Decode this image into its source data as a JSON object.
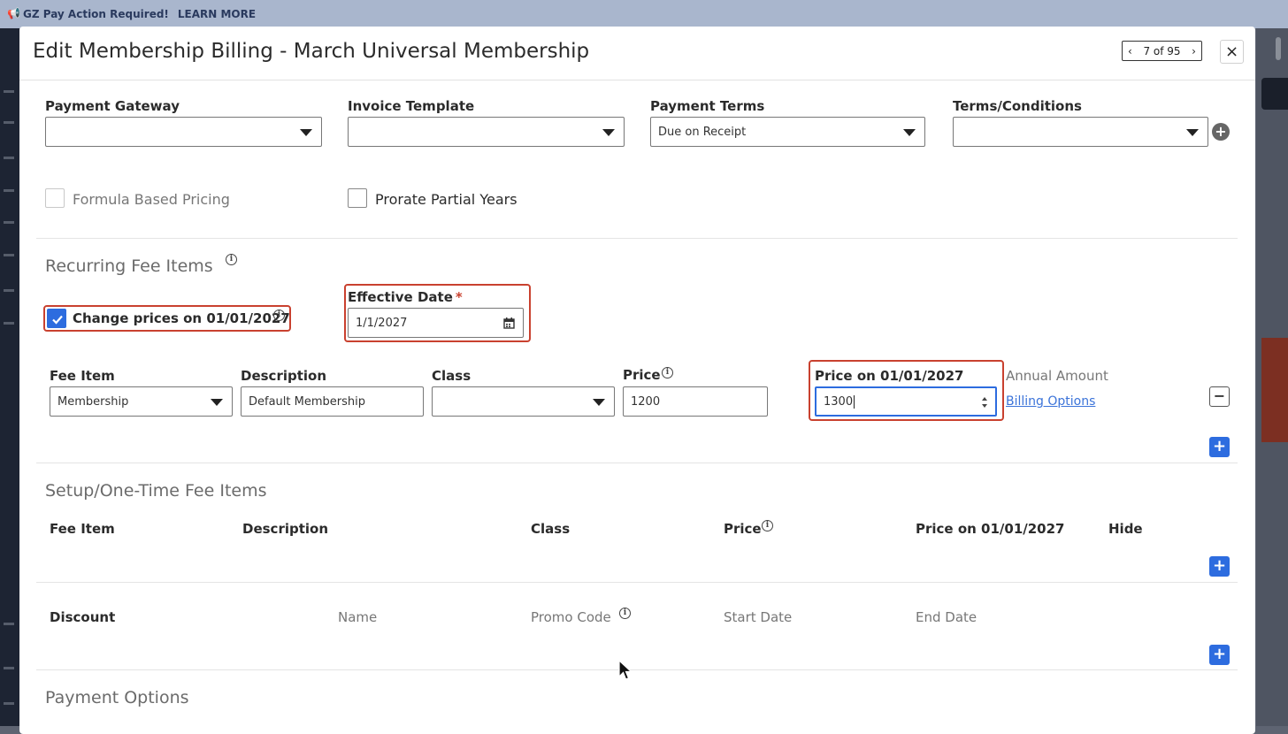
{
  "banner": {
    "text": "GZ Pay Action Required!",
    "link": "LEARN MORE"
  },
  "modal": {
    "title": "Edit Membership Billing - March Universal Membership",
    "pager": "7 of 95",
    "close": "×"
  },
  "top_fields": {
    "payment_gateway": {
      "label": "Payment Gateway",
      "value": ""
    },
    "invoice_template": {
      "label": "Invoice Template",
      "value": ""
    },
    "payment_terms": {
      "label": "Payment Terms",
      "value": "Due on Receipt"
    },
    "terms_conditions": {
      "label": "Terms/Conditions",
      "value": ""
    }
  },
  "options": {
    "formula_based_pricing": "Formula Based Pricing",
    "prorate_partial_years": "Prorate Partial Years"
  },
  "recurring": {
    "title": "Recurring Fee Items",
    "change_prices_label": "Change prices on 01/01/2027",
    "change_prices_checked": true,
    "effective_date_label": "Effective Date",
    "required_mark": "*",
    "effective_date_value": "1/1/2027",
    "headers": {
      "fee_item": "Fee Item",
      "description": "Description",
      "class": "Class",
      "price": "Price",
      "price_on": "Price on 01/01/2027",
      "annual_amount": "Annual Amount"
    },
    "row": {
      "fee_item": "Membership",
      "description": "Default Membership",
      "class": "",
      "price": "1200",
      "price_on": "1300",
      "billing_options": "Billing Options"
    }
  },
  "setup": {
    "title": "Setup/One-Time Fee Items",
    "headers": {
      "fee_item": "Fee Item",
      "description": "Description",
      "class": "Class",
      "price": "Price",
      "price_on": "Price on 01/01/2027",
      "hide": "Hide"
    }
  },
  "discount": {
    "headers": {
      "discount": "Discount",
      "name": "Name",
      "promo_code": "Promo Code",
      "start_date": "Start Date",
      "end_date": "End Date"
    }
  },
  "payment_options": {
    "title": "Payment Options"
  },
  "colors": {
    "accent": "#2d6cdf",
    "highlight": "#c9412f"
  }
}
